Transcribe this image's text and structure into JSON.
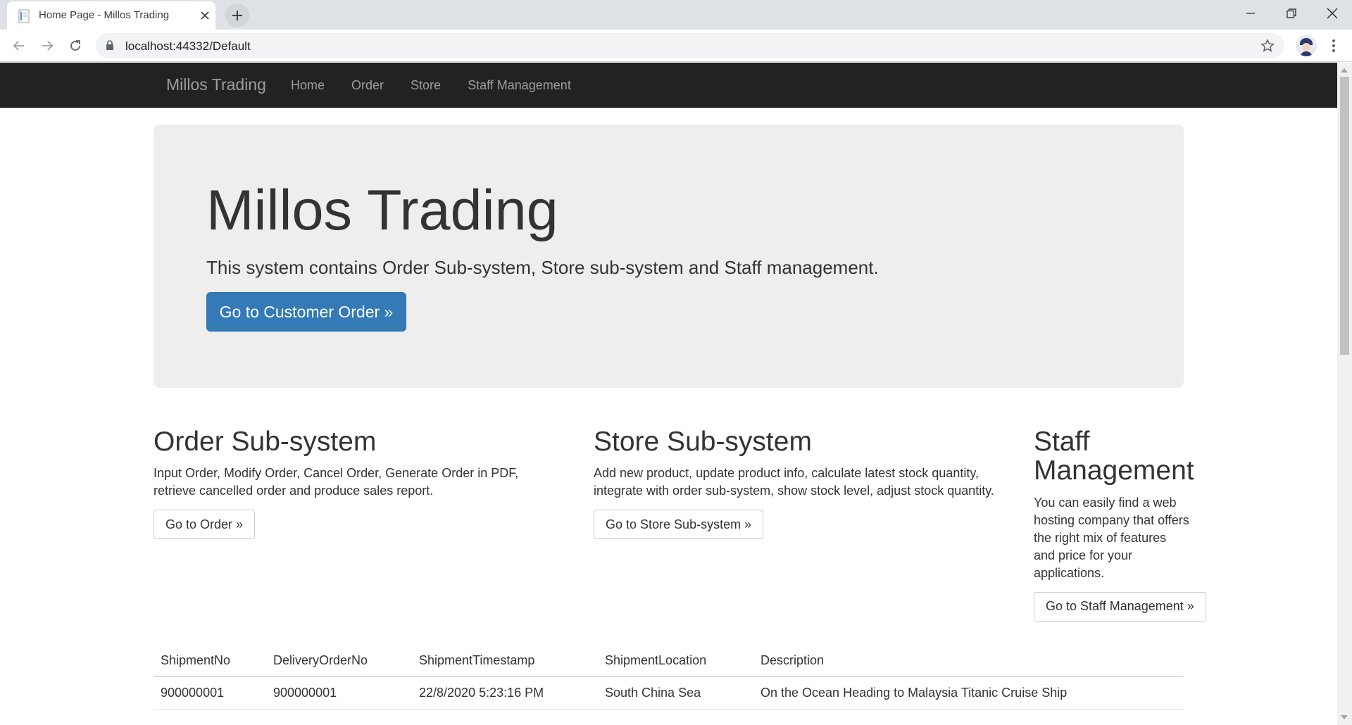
{
  "browser": {
    "tab_title": "Home Page - Millos Trading",
    "url": "localhost:44332/Default"
  },
  "navbar": {
    "brand": "Millos Trading",
    "links": [
      "Home",
      "Order",
      "Store",
      "Staff Management"
    ]
  },
  "jumbotron": {
    "title": "Millos Trading",
    "lead": "This system contains Order Sub-system, Store sub-system and Staff management.",
    "button": "Go to Customer Order »"
  },
  "columns": [
    {
      "title": "Order Sub-system",
      "text": "Input Order, Modify Order, Cancel Order, Generate Order in PDF, retrieve cancelled order and produce sales report.",
      "button": "Go to Order »"
    },
    {
      "title": "Store Sub-system",
      "text": "Add new product, update product info, calculate latest stock quantity, integrate with order sub-system, show stock level, adjust stock quantity.",
      "button": "Go to Store Sub-system »"
    },
    {
      "title": "Staff Management",
      "text": "You can easily find a web hosting company that offers the right mix of features and price for your applications.",
      "button": "Go to Staff Management »"
    }
  ],
  "shipments": {
    "headers": [
      "ShipmentNo",
      "DeliveryOrderNo",
      "ShipmentTimestamp",
      "ShipmentLocation",
      "Description"
    ],
    "rows": [
      [
        "900000001",
        "900000001",
        "22/8/2020 5:23:16 PM",
        "South China Sea",
        "On the Ocean Heading to Malaysia Titanic Cruise Ship"
      ]
    ]
  },
  "colors": {
    "navbar_bg": "#222222",
    "primary": "#337ab7",
    "jumbotron_bg": "#eeeeee"
  }
}
